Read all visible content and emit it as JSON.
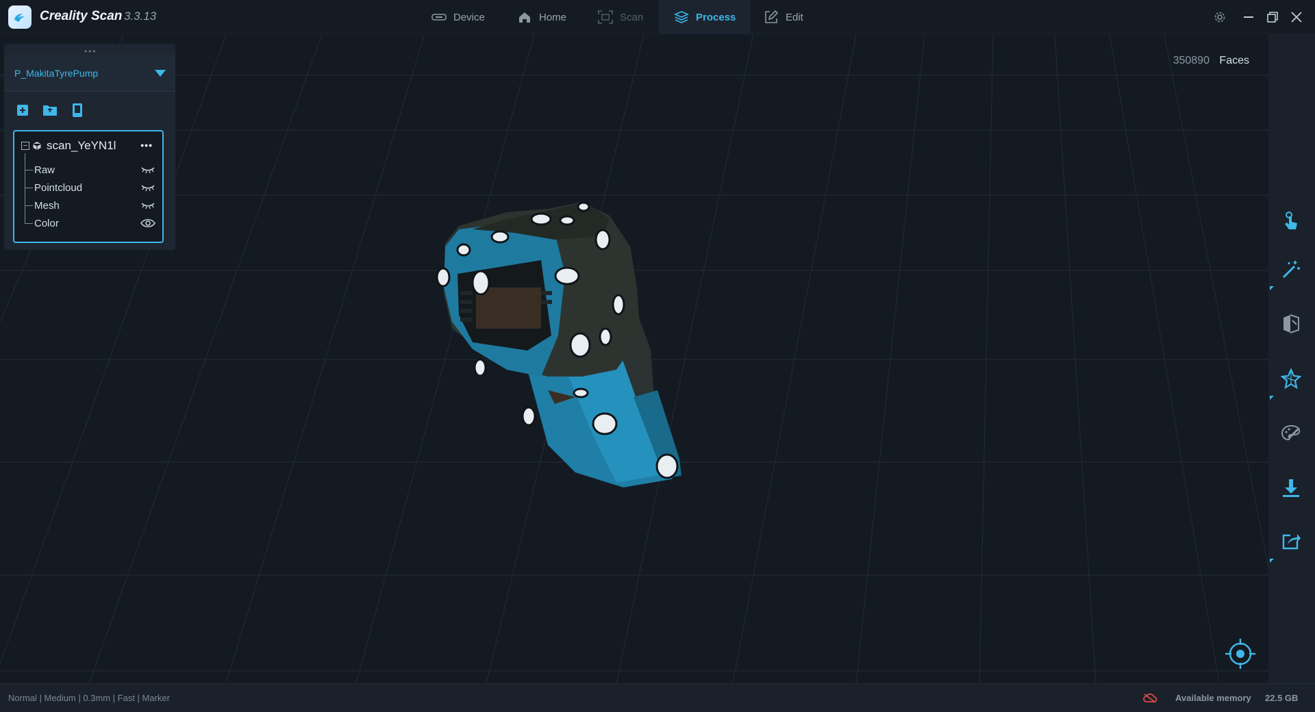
{
  "app": {
    "name": "Creality Scan",
    "version": "3.3.13"
  },
  "tabs": [
    {
      "label": "Device",
      "state": "normal"
    },
    {
      "label": "Home",
      "state": "normal"
    },
    {
      "label": "Scan",
      "state": "disabled"
    },
    {
      "label": "Process",
      "state": "active"
    },
    {
      "label": "Edit",
      "state": "normal"
    }
  ],
  "viewport": {
    "faces_count": "350890",
    "faces_label": "Faces"
  },
  "project": {
    "name": "P_MakitaTyrePump",
    "scan": {
      "name": "scan_YeYN1l",
      "items": [
        {
          "label": "Raw",
          "visibility": "hidden"
        },
        {
          "label": "Pointcloud",
          "visibility": "hidden"
        },
        {
          "label": "Mesh",
          "visibility": "hidden"
        },
        {
          "label": "Color",
          "visibility": "visible"
        }
      ]
    }
  },
  "statusbar": {
    "scan_params": "Normal | Medium | 0.3mm | Fast | Marker",
    "memory_label": "Available memory",
    "memory_value": "22.5 GB"
  },
  "colors": {
    "accent": "#3fb7e8",
    "background": "#151b23",
    "panel": "#1e2631",
    "error": "#e04848"
  }
}
